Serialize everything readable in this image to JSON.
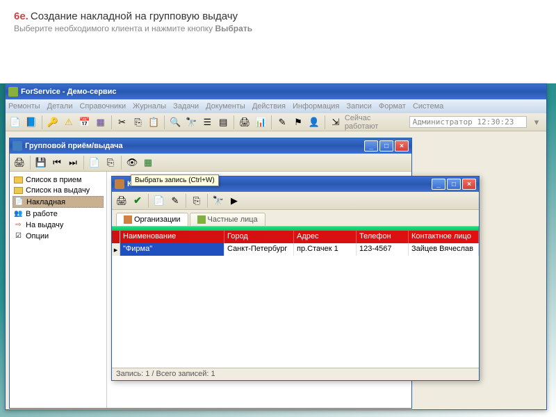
{
  "instruction": {
    "step": "6е.",
    "title": "Создание накладной на групповую выдачу",
    "subtitle_pre": "Выберите необходимого клиента и нажмите кнопку ",
    "subtitle_bold": "Выбрать"
  },
  "main_window": {
    "title": "ForService - Демо-сервис",
    "menu": [
      "Ремонты",
      "Детали",
      "Справочники",
      "Журналы",
      "Задачи",
      "Документы",
      "Действия",
      "Информация",
      "Записи",
      "Формат",
      "Система"
    ],
    "status_label": "Сейчас работают",
    "status_value": "Администратор 12:30:23"
  },
  "sub_window": {
    "title": "Групповой приём/выдача",
    "tree": [
      {
        "label": "Список в прием",
        "icon": "folder"
      },
      {
        "label": "Список на выдачу",
        "icon": "folder"
      },
      {
        "label": "Накладная",
        "icon": "doc",
        "selected": true
      },
      {
        "label": "В работе",
        "icon": "gear"
      },
      {
        "label": "На выдачу",
        "icon": "out"
      },
      {
        "label": "Опции",
        "icon": "opt"
      }
    ]
  },
  "tooltip": "Выбрать запись (Ctrl+W)",
  "popup": {
    "title": "Кли",
    "tabs": [
      {
        "label": "Организации",
        "active": true
      },
      {
        "label": "Частные лица",
        "active": false
      }
    ],
    "columns": [
      "Наименование",
      "Город",
      "Адрес",
      "Телефон",
      "Контактное лицо"
    ],
    "row": {
      "name": "\"Фирма\"",
      "city": "Санкт-Петербург",
      "addr": "пр.Стачек 1",
      "phone": "123-4567",
      "contact": "Зайцев Вячеслав"
    },
    "status": "Запись: 1 / Всего записей: 1"
  }
}
